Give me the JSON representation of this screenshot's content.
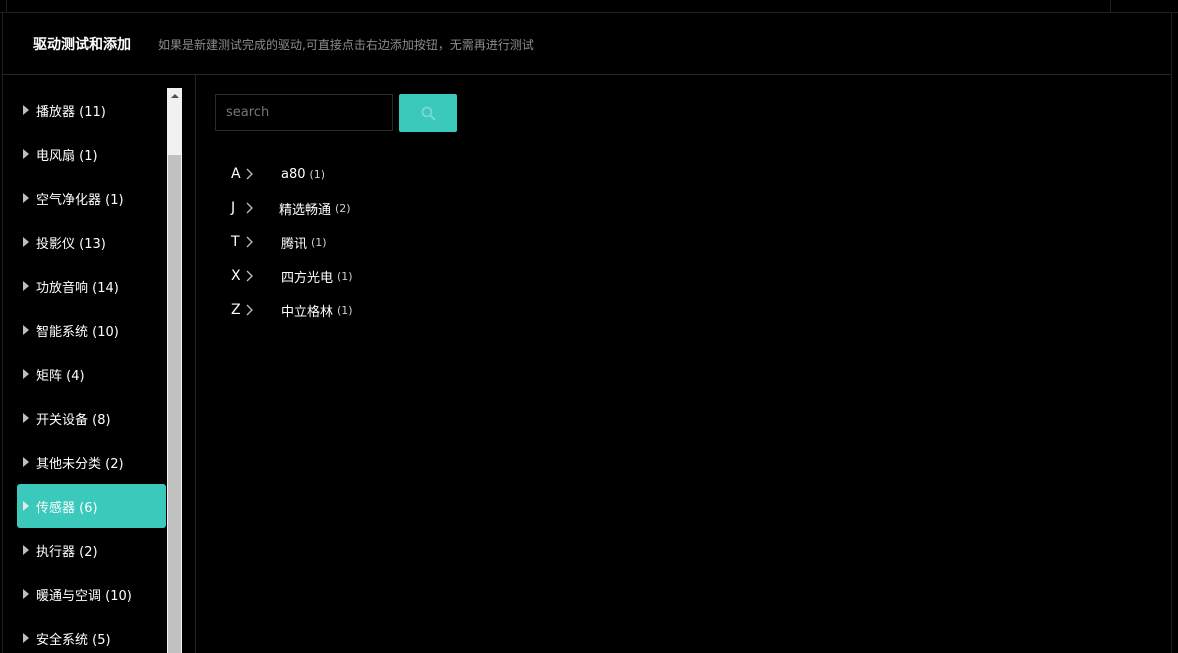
{
  "header": {
    "title": "驱动测试和添加",
    "hint": "如果是新建测试完成的驱动,可直接点击右边添加按钮，无需再进行测试"
  },
  "sidebar": {
    "items": [
      {
        "label": "播放器 (11)"
      },
      {
        "label": "电风扇 (1)"
      },
      {
        "label": "空气净化器 (1)"
      },
      {
        "label": "投影仪 (13)"
      },
      {
        "label": "功放音响 (14)"
      },
      {
        "label": "智能系统 (10)"
      },
      {
        "label": "矩阵 (4)"
      },
      {
        "label": "开关设备 (8)"
      },
      {
        "label": "其他未分类 (2)"
      },
      {
        "label": "传感器 (6)",
        "active": true
      },
      {
        "label": "执行器 (2)"
      },
      {
        "label": "暖通与空调 (10)"
      },
      {
        "label": "安全系统 (5)"
      }
    ],
    "active_index": 9
  },
  "search": {
    "placeholder": "search",
    "value": "",
    "button_icon": "search-icon"
  },
  "brands": [
    {
      "letter": "A",
      "name": "a80",
      "count": "(1)"
    },
    {
      "letter": "J",
      "name": "精选畅通",
      "count": "(2)"
    },
    {
      "letter": "T",
      "name": "腾讯",
      "count": "(1)"
    },
    {
      "letter": "X",
      "name": "四方光电",
      "count": "(1)"
    },
    {
      "letter": "Z",
      "name": "中立格林",
      "count": "(1)"
    }
  ],
  "colors": {
    "accent": "#3ac9bb",
    "background": "#000000",
    "hint_text": "#8c8c8c"
  }
}
